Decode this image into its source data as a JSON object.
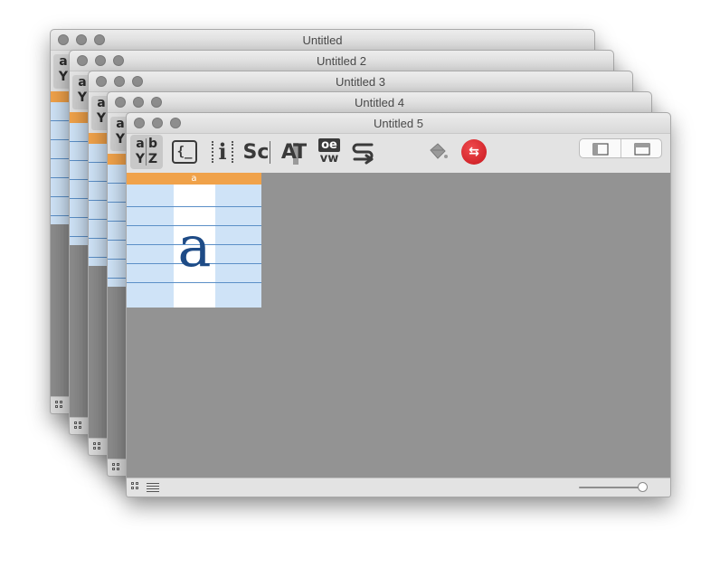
{
  "windows": {
    "w1": {
      "title": "Untitled",
      "partial": {
        "top": "a",
        "bottom": "Y"
      }
    },
    "w2": {
      "title": "Untitled 2",
      "partial": {
        "top": "a",
        "bottom": "Y"
      }
    },
    "w3": {
      "title": "Untitled 3",
      "partial": {
        "top": "a",
        "bottom": "Y"
      }
    },
    "w4": {
      "title": "Untitled 4",
      "partial": {
        "top": "a",
        "bottom": "Y"
      }
    },
    "w5": {
      "title": "Untitled 5",
      "toolbar": {
        "glyph_tool": {
          "icon": "abyz-icon",
          "text": [
            "a",
            "b",
            "Y",
            "Z"
          ],
          "active": true
        },
        "code_tool": {
          "icon": "code-icon",
          "text": "{_"
        },
        "info_tool": {
          "icon": "info-icon",
          "text": "i"
        },
        "smallcaps_tool": {
          "icon": "smallcaps-icon",
          "text": "Sc"
        },
        "kerning_tool": {
          "icon": "kerning-icon",
          "text": "AT"
        },
        "ligature_tool": {
          "icon": "ligature-icon",
          "text": [
            "oe",
            "vw"
          ]
        },
        "flow_tool": {
          "icon": "flow-icon",
          "text": "S"
        },
        "fill_tool": {
          "icon": "paint-bucket-icon"
        },
        "compare_tool": {
          "icon": "compare-arrows-icon",
          "color": "#d9262b"
        },
        "view_toggle": [
          {
            "icon": "sidebar-left-icon"
          },
          {
            "icon": "sidebar-right-icon"
          }
        ]
      },
      "glyph_cell": {
        "header": "a",
        "glyph": "a"
      },
      "statusbar": {
        "grid_icon": "grid-view-icon",
        "list_icon": "list-view-icon",
        "zoom_fraction": 0.98
      }
    }
  },
  "colors": {
    "accent_orange": "#f0a24a",
    "cell_blue": "#cfe3f7",
    "metric_line": "#5b8fc7",
    "glyph_color": "#1e4b86"
  }
}
